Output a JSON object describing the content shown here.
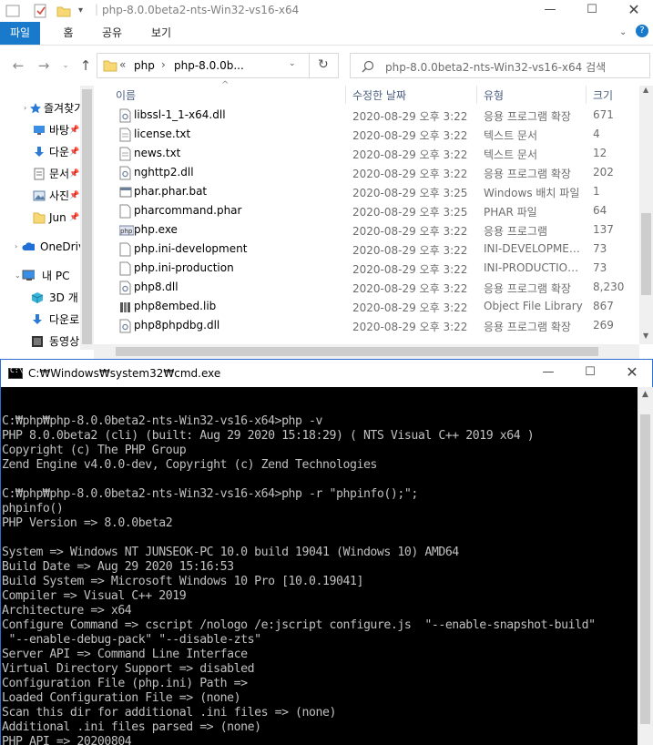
{
  "explorer": {
    "title": "php-8.0.0beta2-nts-Win32-vs16-x64",
    "ribbon_tabs": [
      "파일",
      "홈",
      "공유",
      "보기"
    ],
    "address": {
      "chevron": "«",
      "crumbs": [
        "php",
        "php-8.0.0b..."
      ]
    },
    "search_placeholder": "php-8.0.0beta2-nts-Win32-vs16-x64 검색",
    "nav": [
      {
        "label": "즐겨찾기",
        "icon": "star-icon"
      },
      {
        "label": "바탕",
        "icon": "desktop-icon"
      },
      {
        "label": "다운",
        "icon": "download-icon"
      },
      {
        "label": "문서",
        "icon": "document-icon"
      },
      {
        "label": "사진",
        "icon": "pictures-icon"
      },
      {
        "label": "Jun",
        "icon": "folder-icon"
      },
      {
        "label": "OneDriv",
        "icon": "cloud-icon"
      },
      {
        "label": "내 PC",
        "icon": "pc-icon"
      },
      {
        "label": "3D 개",
        "icon": "cube-icon"
      },
      {
        "label": "다운로",
        "icon": "download-icon"
      },
      {
        "label": "동영상",
        "icon": "video-icon"
      }
    ],
    "columns": {
      "name": "이름",
      "date": "수정한 날짜",
      "type": "유형",
      "size": "크기"
    },
    "files": [
      {
        "name": "libssl-1_1-x64.dll",
        "date": "2020-08-29 오후 3:22",
        "type": "응용 프로그램 확장",
        "size": "671",
        "icon": "dll-icon"
      },
      {
        "name": "license.txt",
        "date": "2020-08-29 오후 3:22",
        "type": "텍스트 문서",
        "size": "4",
        "icon": "text-file-icon"
      },
      {
        "name": "news.txt",
        "date": "2020-08-29 오후 3:22",
        "type": "텍스트 문서",
        "size": "12",
        "icon": "text-file-icon"
      },
      {
        "name": "nghttp2.dll",
        "date": "2020-08-29 오후 3:22",
        "type": "응용 프로그램 확장",
        "size": "202",
        "icon": "dll-icon"
      },
      {
        "name": "phar.phar.bat",
        "date": "2020-08-29 오후 3:25",
        "type": "Windows 배치 파일",
        "size": "1",
        "icon": "batch-icon"
      },
      {
        "name": "pharcommand.phar",
        "date": "2020-08-29 오후 3:25",
        "type": "PHAR 파일",
        "size": "64",
        "icon": "file-icon"
      },
      {
        "name": "php.exe",
        "date": "2020-08-29 오후 3:22",
        "type": "응용 프로그램",
        "size": "137",
        "icon": "php-exe-icon"
      },
      {
        "name": "php.ini-development",
        "date": "2020-08-29 오후 3:22",
        "type": "INI-DEVELOPMEN...",
        "size": "73",
        "icon": "file-icon"
      },
      {
        "name": "php.ini-production",
        "date": "2020-08-29 오후 3:22",
        "type": "INI-PRODUCTION...",
        "size": "73",
        "icon": "file-icon"
      },
      {
        "name": "php8.dll",
        "date": "2020-08-29 오후 3:22",
        "type": "응용 프로그램 확장",
        "size": "8,230",
        "icon": "dll-icon"
      },
      {
        "name": "php8embed.lib",
        "date": "2020-08-29 오후 3:22",
        "type": "Object File Library",
        "size": "867",
        "icon": "lib-icon"
      },
      {
        "name": "php8phpdbg.dll",
        "date": "2020-08-29 오후 3:22",
        "type": "응용 프로그램 확장",
        "size": "269",
        "icon": "dll-icon"
      }
    ]
  },
  "cmd": {
    "title": "C:₩Windows₩system32₩cmd.exe",
    "lines": [
      "",
      "C:₩php₩php-8.0.0beta2-nts-Win32-vs16-x64>php -v",
      "PHP 8.0.0beta2 (cli) (built: Aug 29 2020 15:18:29) ( NTS Visual C++ 2019 x64 )",
      "Copyright (c) The PHP Group",
      "Zend Engine v4.0.0-dev, Copyright (c) Zend Technologies",
      "",
      "C:₩php₩php-8.0.0beta2-nts-Win32-vs16-x64>php -r \"phpinfo();\";",
      "phpinfo()",
      "PHP Version => 8.0.0beta2",
      "",
      "System => Windows NT JUNSEOK-PC 10.0 build 19041 (Windows 10) AMD64",
      "Build Date => Aug 29 2020 15:16:53",
      "Build System => Microsoft Windows 10 Pro [10.0.19041]",
      "Compiler => Visual C++ 2019",
      "Architecture => x64",
      "Configure Command => cscript /nologo /e:jscript configure.js  \"--enable-snapshot-build\"",
      " \"--enable-debug-pack\" \"--disable-zts\"",
      "Server API => Command Line Interface",
      "Virtual Directory Support => disabled",
      "Configuration File (php.ini) Path =>",
      "Loaded Configuration File => (none)",
      "Scan this dir for additional .ini files => (none)",
      "Additional .ini files parsed => (none)",
      "PHP API => 20200804"
    ]
  },
  "colors": {
    "ribbon_active": "#1979ca",
    "cmd_background": "#000000",
    "cmd_text": "#c0c0c0",
    "header_text": "#4d6082",
    "folder": "#f8d775"
  }
}
